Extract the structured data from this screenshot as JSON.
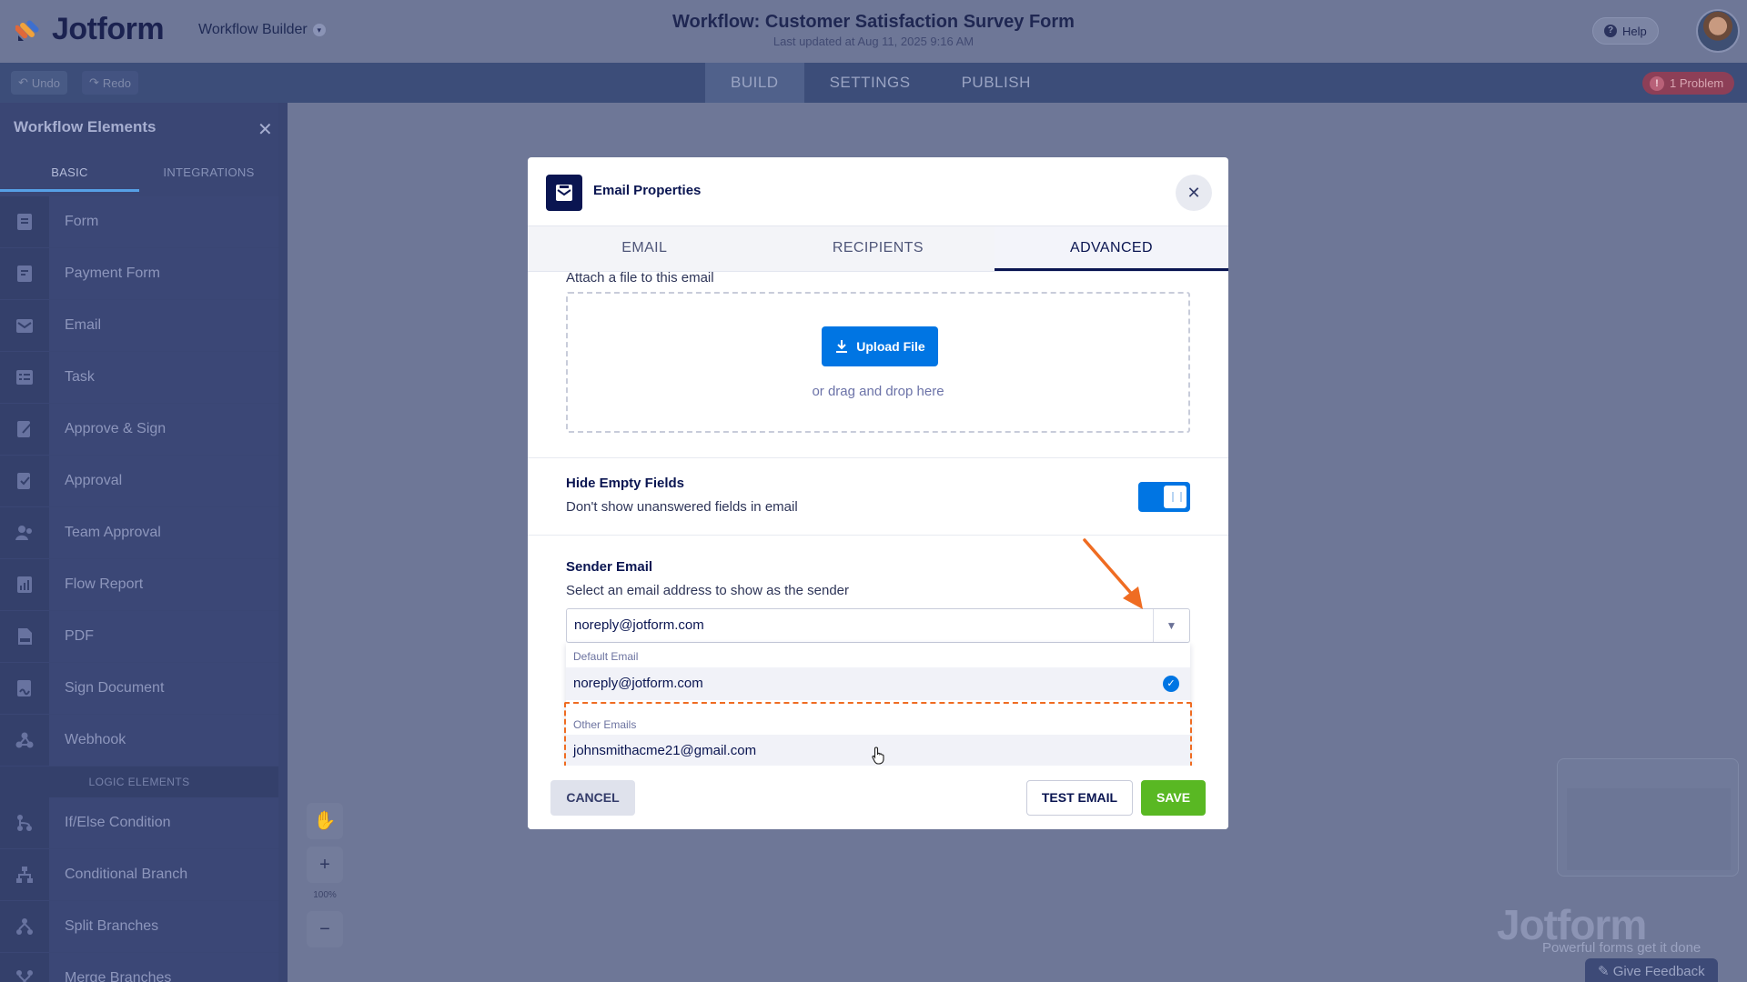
{
  "header": {
    "logo_text": "Jotform",
    "builder_label": "Workflow Builder",
    "title": "Workflow: Customer Satisfaction Survey Form",
    "updated": "Last updated at Aug 11, 2025 9:16 AM",
    "help_label": "Help"
  },
  "toolbar": {
    "undo_label": "Undo",
    "redo_label": "Redo",
    "tabs": [
      "BUILD",
      "SETTINGS",
      "PUBLISH"
    ],
    "active_tab": "BUILD",
    "problem_label": "1 Problem"
  },
  "sidebar": {
    "title": "Workflow Elements",
    "tabs": [
      "BASIC",
      "INTEGRATIONS"
    ],
    "items": [
      "Form",
      "Payment Form",
      "Email",
      "Task",
      "Approve & Sign",
      "Approval",
      "Team Approval",
      "Flow Report",
      "PDF",
      "Sign Document",
      "Webhook"
    ],
    "logic_section": "LOGIC ELEMENTS",
    "logic_items": [
      "If/Else Condition",
      "Conditional Branch",
      "Split Branches",
      "Merge Branches"
    ]
  },
  "canvas": {
    "zoom": "100%",
    "watermark": "Jotform",
    "watermark_sub": "Powerful forms get it done",
    "feedback_label": "Give Feedback"
  },
  "modal": {
    "title": "Email Properties",
    "tabs": [
      "EMAIL",
      "RECIPIENTS",
      "ADVANCED"
    ],
    "active_tab": "ADVANCED",
    "attach_label": "Attach a file to this email",
    "upload_label": "Upload File",
    "drag_text": "or drag and drop here",
    "hide_empty": {
      "title": "Hide Empty Fields",
      "desc": "Don't show unanswered fields in email",
      "enabled": true
    },
    "sender": {
      "title": "Sender Email",
      "desc": "Select an email address to show as the sender",
      "selected": "noreply@jotform.com",
      "default_group": "Default Email",
      "default_option": "noreply@jotform.com",
      "other_group": "Other Emails",
      "other_option": "johnsmithacme21@gmail.com"
    },
    "cancel_label": "CANCEL",
    "test_label": "TEST EMAIL",
    "save_label": "SAVE"
  },
  "colors": {
    "accent_blue": "#0075e3",
    "save_green": "#59b823",
    "annotation_orange": "#ef6c22",
    "navy": "#0a1551"
  }
}
